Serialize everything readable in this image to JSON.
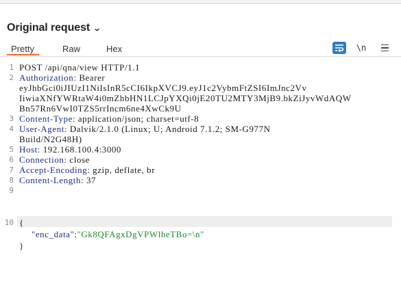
{
  "panel": {
    "title": "Original request",
    "tabs": [
      "Pretty",
      "Raw",
      "Hex"
    ],
    "active_tab": "Pretty",
    "newline_toggle": "\\n",
    "accent_color": "#e8702a",
    "wrap_button_color": "#2e7fc1"
  },
  "request": {
    "line1": "POST /api/qna/view HTTP/1.1",
    "authorization": {
      "name": "Authorization:",
      "value": " Bearer"
    },
    "token_line1": "eyJhbGci0iJIUzI1NiIsInR5cCI6IkpXVCJ9.eyJ1c2VybmFtZSI6ImJnc2Vv",
    "token_line2": "IiwiaXNfYWRtaW4i0mZhbHN1LCJpYXQi0jE20TU2MTY3MjB9.bkZiJyvWdAQW",
    "token_line3": "Bn57Rn6VwI0TZS5rrIncm6ne4XwCk9U",
    "content_type": {
      "name": "Content-Type:",
      "value": " application/json; charset=utf-8"
    },
    "user_agent": {
      "name": "User-Agent:",
      "value": " Dalvik/2.1.0 (Linux; U; Android 7.1.2; SM-G977N"
    },
    "user_agent_cont": "Build/N2G48H)",
    "host": {
      "name": "Host:",
      "value": " 192.168.100.4:3000"
    },
    "connection": {
      "name": "Connection:",
      "value": " close"
    },
    "accept_encoding": {
      "name": "Accept-Encoding:",
      "value": " gzip, deflate, br"
    },
    "content_length": {
      "name": "Content-Length:",
      "value": " 37"
    },
    "body_open": "{",
    "body_key": "\"enc_data\"",
    "body_colon": ":",
    "body_value": "\"Gk8QFAgxDgVPWlheTBo=\\n\"",
    "body_close": "}"
  },
  "line_numbers": [
    "1",
    "2",
    "3",
    "4",
    "5",
    "6",
    "7",
    "8",
    "9",
    "10"
  ]
}
